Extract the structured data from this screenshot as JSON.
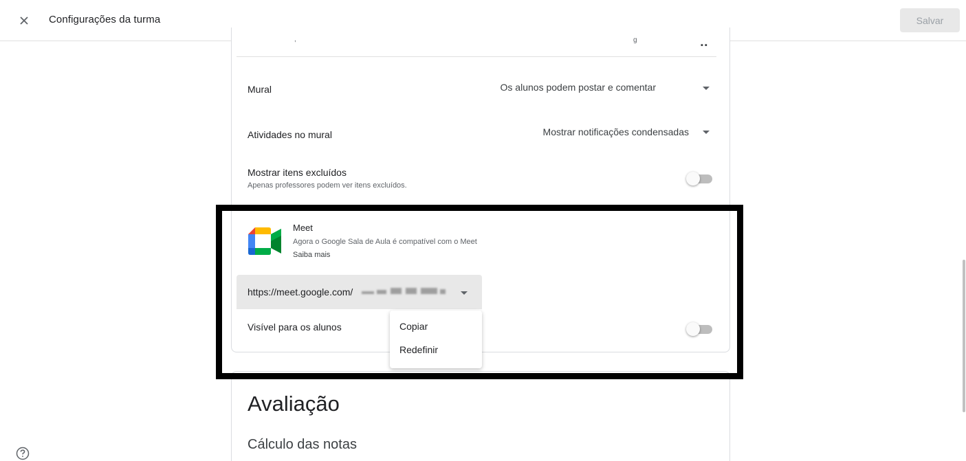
{
  "header": {
    "title": "Configurações da turma",
    "save_label": "Salvar"
  },
  "settings": {
    "stream": {
      "label": "Mural",
      "value": "Os alunos podem postar e comentar"
    },
    "stream_activity": {
      "label": "Atividades no mural",
      "value": "Mostrar notificações condensadas"
    },
    "show_deleted": {
      "label": "Mostrar itens excluídos",
      "sublabel": "Apenas professores podem ver itens excluídos.",
      "enabled": false
    }
  },
  "meet": {
    "title": "Meet",
    "description": "Agora o Google Sala de Aula é compatível com o Meet",
    "learn_more": "Saiba mais",
    "link_prefix": "https://meet.google.com/",
    "visible_label": "Visível para os alunos",
    "visible_enabled": false,
    "menu": {
      "copy": "Copiar",
      "reset": "Redefinir"
    }
  },
  "grading": {
    "title": "Avaliação",
    "subtitle": "Cálculo das notas"
  },
  "colors": {
    "save_bg": "#e8e8e8",
    "frame": "#000000",
    "meet_blue": "#4285f4",
    "meet_green": "#00ac47",
    "meet_yellow": "#ffba00",
    "meet_red": "#ea4335"
  },
  "icons": {
    "close": "close-icon",
    "dropdown": "arrow-drop-down-icon",
    "meet": "google-meet-icon",
    "help": "help-icon"
  }
}
